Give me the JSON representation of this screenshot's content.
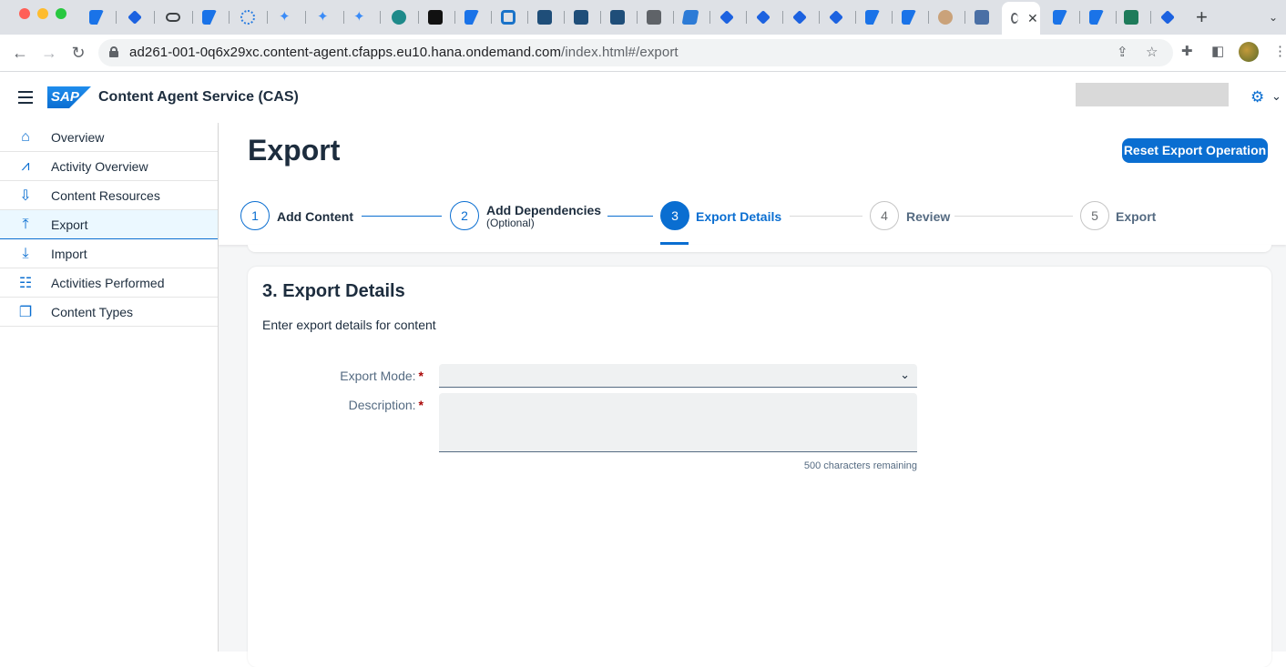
{
  "browser": {
    "tabs": [
      {
        "icon": "sap-icon"
      },
      {
        "icon": "diamond-icon"
      },
      {
        "icon": "infinity-icon"
      },
      {
        "icon": "sap-icon"
      },
      {
        "icon": "network-icon"
      },
      {
        "icon": "sparkle-icon"
      },
      {
        "icon": "sparkle-icon"
      },
      {
        "icon": "sparkle-icon"
      },
      {
        "icon": "globe-gem-icon"
      },
      {
        "icon": "github-icon"
      },
      {
        "icon": "sap-icon"
      },
      {
        "icon": "azure-icon"
      },
      {
        "icon": "play-icon"
      },
      {
        "icon": "play-icon"
      },
      {
        "icon": "play-icon"
      },
      {
        "icon": "globe-icon"
      },
      {
        "icon": "visual-studio-icon"
      },
      {
        "icon": "diamond-icon"
      },
      {
        "icon": "diamond-icon"
      },
      {
        "icon": "diamond-icon"
      },
      {
        "icon": "diamond-icon"
      },
      {
        "icon": "sap-icon"
      },
      {
        "icon": "sap-icon"
      },
      {
        "icon": "avatar-icon"
      },
      {
        "icon": "cloud-icon"
      },
      {
        "icon": "active-tab"
      },
      {
        "icon": "sap-icon"
      },
      {
        "icon": "sap-icon"
      },
      {
        "icon": "sharepoint-icon"
      },
      {
        "icon": "diamond-icon"
      }
    ],
    "active_tab_close": "✕",
    "new_tab": "+",
    "url_host": "ad261-001-0q6x29xc.content-agent.cfapps.eu10.hana.ondemand.com",
    "url_path": "/index.html#/export"
  },
  "shell": {
    "logo": "SAP",
    "title": "Content Agent Service (CAS)"
  },
  "sidebar": {
    "items": [
      {
        "label": "Overview",
        "icon": "home-icon",
        "glyph": "⌂"
      },
      {
        "label": "Activity Overview",
        "icon": "chart-line-icon",
        "glyph": "📈"
      },
      {
        "label": "Content Resources",
        "icon": "download-tray-icon",
        "glyph": "⇩"
      },
      {
        "label": "Export",
        "icon": "upload-icon",
        "glyph": "⤒"
      },
      {
        "label": "Import",
        "icon": "download-icon",
        "glyph": "⤓"
      },
      {
        "label": "Activities Performed",
        "icon": "checklist-icon",
        "glyph": "☷"
      },
      {
        "label": "Content Types",
        "icon": "layers-icon",
        "glyph": "❐"
      }
    ],
    "selected": "Export"
  },
  "header": {
    "title": "Export",
    "reset_button": "Reset Export Operation"
  },
  "wizard": {
    "steps": [
      {
        "number": "1",
        "label": "Add Content",
        "sub": "",
        "state": "done"
      },
      {
        "number": "2",
        "label": "Add Dependencies",
        "sub": "(Optional)",
        "state": "done"
      },
      {
        "number": "3",
        "label": "Export Details",
        "sub": "",
        "state": "active"
      },
      {
        "number": "4",
        "label": "Review",
        "sub": "",
        "state": "todo"
      },
      {
        "number": "5",
        "label": "Export",
        "sub": "",
        "state": "todo"
      }
    ]
  },
  "form": {
    "title": "3. Export Details",
    "subtitle": "Enter export details for content",
    "export_mode_label": "Export Mode:",
    "export_mode_value": "",
    "description_label": "Description:",
    "description_value": "",
    "required_marker": "*",
    "counter": "500 characters remaining"
  },
  "colors": {
    "accent": "#0a6ed1",
    "required": "#aa0808"
  }
}
